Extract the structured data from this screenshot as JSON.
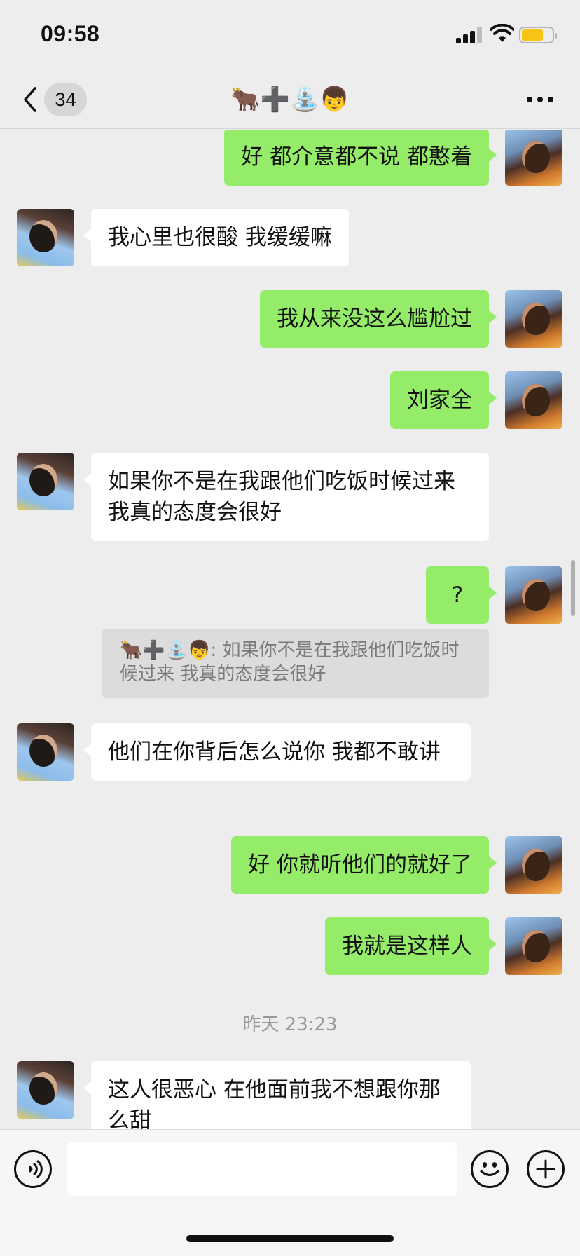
{
  "status_bar": {
    "time": "09:58",
    "battery_color": "#f7c416"
  },
  "nav": {
    "back_icon": "chevron-left-icon",
    "unread_count": "34",
    "title": "🐂➕⛲👦",
    "more_icon": "more-dots-icon"
  },
  "messages": [
    {
      "side": "me",
      "text": "好 都介意都不说 都憨着"
    },
    {
      "side": "them",
      "text": "我心里也很酸 我缓缓嘛"
    },
    {
      "side": "me",
      "text": "我从来没这么尴尬过"
    },
    {
      "side": "me",
      "text": "刘家全"
    },
    {
      "side": "them",
      "text": "如果你不是在我跟他们吃饭时候过来 我真的态度会很好"
    },
    {
      "side": "me",
      "text": "?"
    },
    {
      "side": "quote",
      "name": "🐂➕⛲👦",
      "separator": ":",
      "text": "如果你不是在我跟他们吃饭时候过来 我真的态度会很好"
    },
    {
      "side": "them",
      "text": "他们在你背后怎么说你 我都不敢讲"
    },
    {
      "side": "me",
      "text": "好 你就听他们的就好了"
    },
    {
      "side": "me",
      "text": "我就是这样人"
    },
    {
      "side": "time",
      "text": "昨天 23:23"
    },
    {
      "side": "them",
      "text": "这人很恶心 在他面前我不想跟你那么甜"
    }
  ],
  "input_bar": {
    "voice_icon": "voice-icon",
    "emoji_icon": "emoji-icon",
    "plus_icon": "plus-icon",
    "placeholder": ""
  },
  "colors": {
    "my_bubble": "#95ec69",
    "their_bubble": "#ffffff",
    "background": "#ededed"
  }
}
